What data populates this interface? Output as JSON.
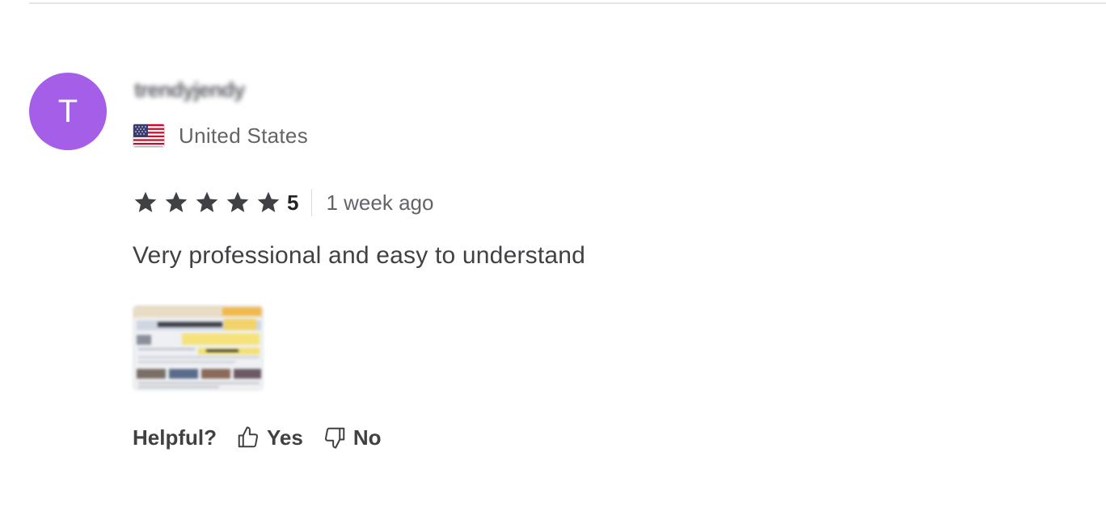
{
  "reviewer": {
    "avatar_initial": "T",
    "avatar_color": "#a55ee8",
    "username": "trendyjendy",
    "country": "United States",
    "flag_icon": "us-flag-icon"
  },
  "review": {
    "rating": 5,
    "rating_label": "5",
    "time_ago": "1 week ago",
    "text": "Very professional and easy to understand",
    "star_color": "#404145"
  },
  "helpful": {
    "label": "Helpful?",
    "yes_label": "Yes",
    "no_label": "No",
    "yes_icon": "thumbs-up-icon",
    "no_icon": "thumbs-down-icon"
  }
}
